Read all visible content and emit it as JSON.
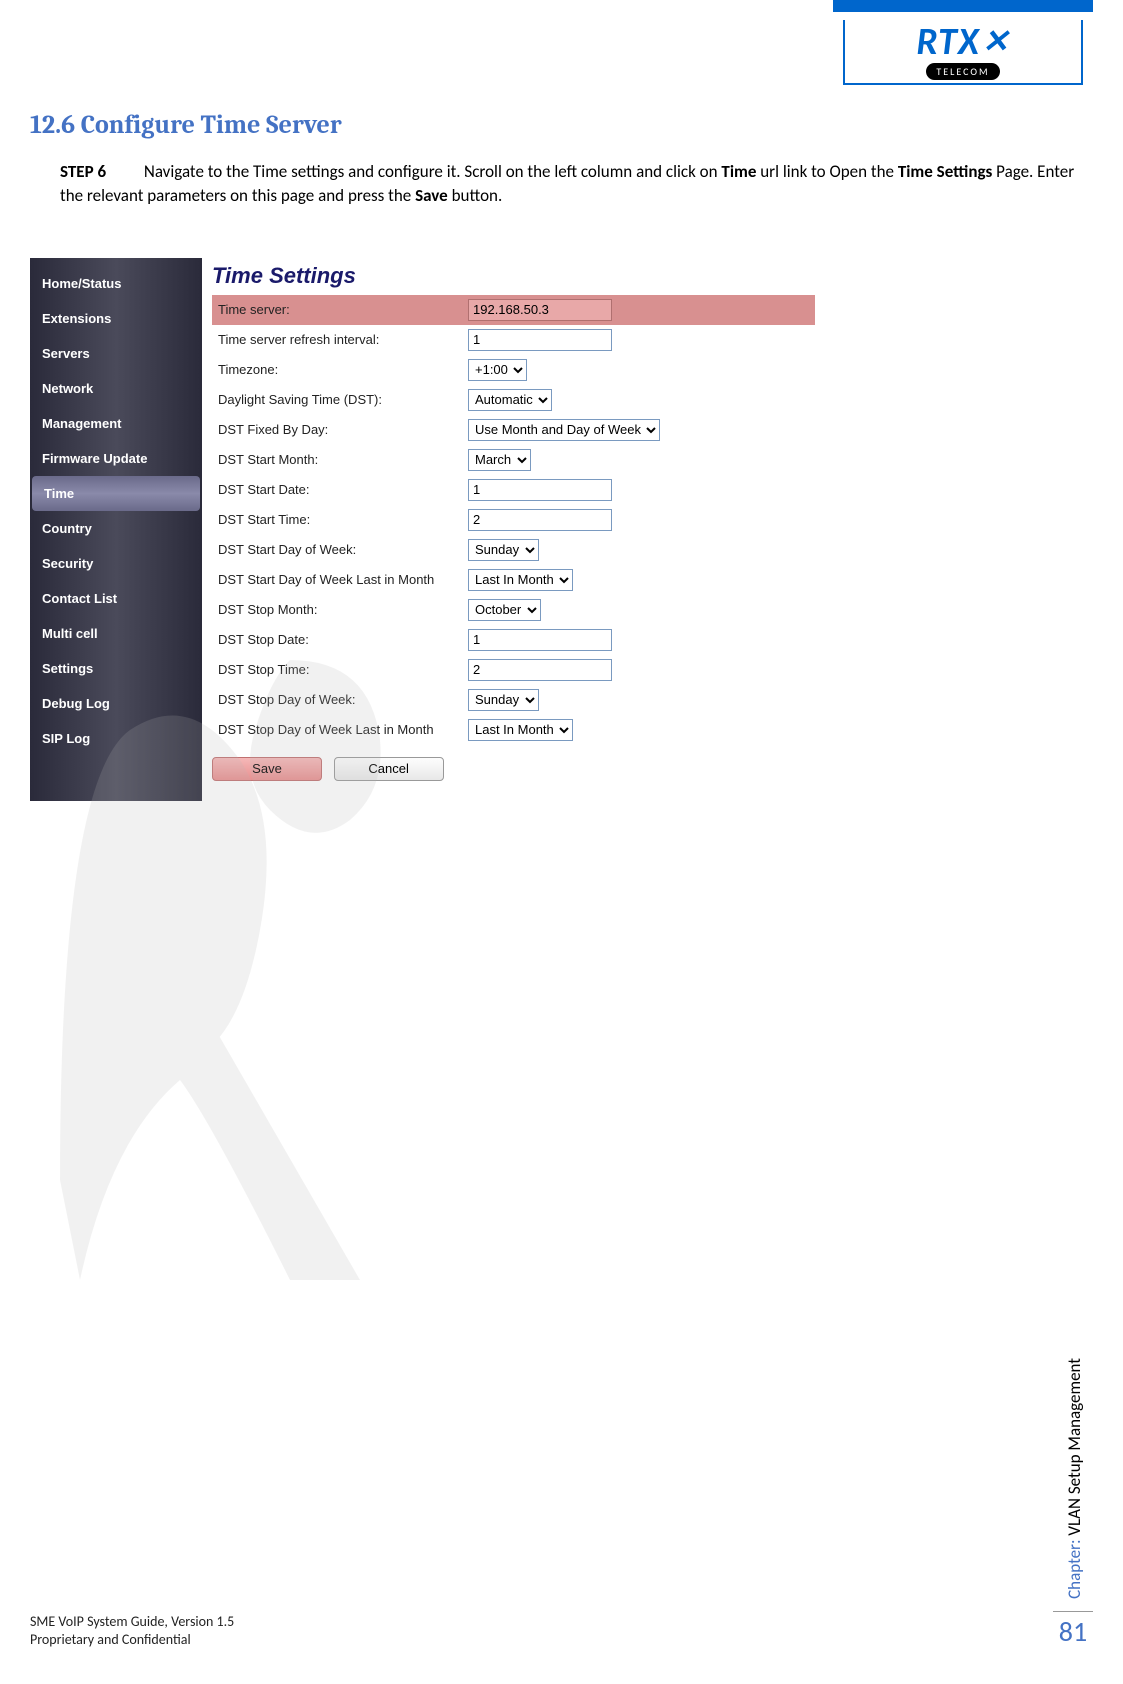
{
  "logo": {
    "brand": "RTX",
    "sub": "TELECOM"
  },
  "section": {
    "number": "12.6",
    "title": "Configure Time Server"
  },
  "step": {
    "label": "STEP 6",
    "text_parts": {
      "p1": "Navigate to the Time settings and configure it. Scroll on the left column and click on ",
      "b1": "Time",
      "p2": " url link to Open the ",
      "b2": "Time Settings",
      "p3": " Page. Enter the relevant parameters on this page and press the ",
      "b3": "Save",
      "p4": " button."
    }
  },
  "sidebar": {
    "items": [
      "Home/Status",
      "Extensions",
      "Servers",
      "Network",
      "Management",
      "Firmware Update",
      "Time",
      "Country",
      "Security",
      "Contact List",
      "Multi cell",
      "Settings",
      "Debug Log",
      "SIP Log"
    ],
    "active_index": 6
  },
  "panel": {
    "title": "Time Settings",
    "rows": [
      {
        "label": "Time server:",
        "type": "text",
        "value": "192.168.50.3",
        "highlight": true,
        "width": "w140"
      },
      {
        "label": "Time server refresh interval:",
        "type": "text",
        "value": "1",
        "width": "w140"
      },
      {
        "label": "Timezone:",
        "type": "select",
        "value": "+1:00"
      },
      {
        "label": "Daylight Saving Time (DST):",
        "type": "select",
        "value": "Automatic"
      },
      {
        "label": "DST Fixed By Day:",
        "type": "select",
        "value": "Use Month and Day of Week"
      },
      {
        "label": "DST Start Month:",
        "type": "select",
        "value": "March"
      },
      {
        "label": "DST Start Date:",
        "type": "text",
        "value": "1",
        "width": "w140"
      },
      {
        "label": "DST Start Time:",
        "type": "text",
        "value": "2",
        "width": "w140"
      },
      {
        "label": "DST Start Day of Week:",
        "type": "select",
        "value": "Sunday"
      },
      {
        "label": "DST Start Day of Week Last in Month",
        "type": "select",
        "value": "Last In Month"
      },
      {
        "label": "DST Stop Month:",
        "type": "select",
        "value": "October"
      },
      {
        "label": "DST Stop Date:",
        "type": "text",
        "value": "1",
        "width": "w140"
      },
      {
        "label": "DST Stop Time:",
        "type": "text",
        "value": "2",
        "width": "w140"
      },
      {
        "label": "DST Stop Day of Week:",
        "type": "select",
        "value": "Sunday"
      },
      {
        "label": "DST Stop Day of Week Last in Month",
        "type": "select",
        "value": "Last In Month"
      }
    ],
    "buttons": {
      "save": "Save",
      "cancel": "Cancel"
    }
  },
  "side_chapter": {
    "label": "Chapter:",
    "value": "VLAN Setup Management"
  },
  "page_number": "81",
  "footer": {
    "line1": "SME VoIP System Guide, Version 1.5",
    "line2": "Proprietary and Confidential"
  }
}
